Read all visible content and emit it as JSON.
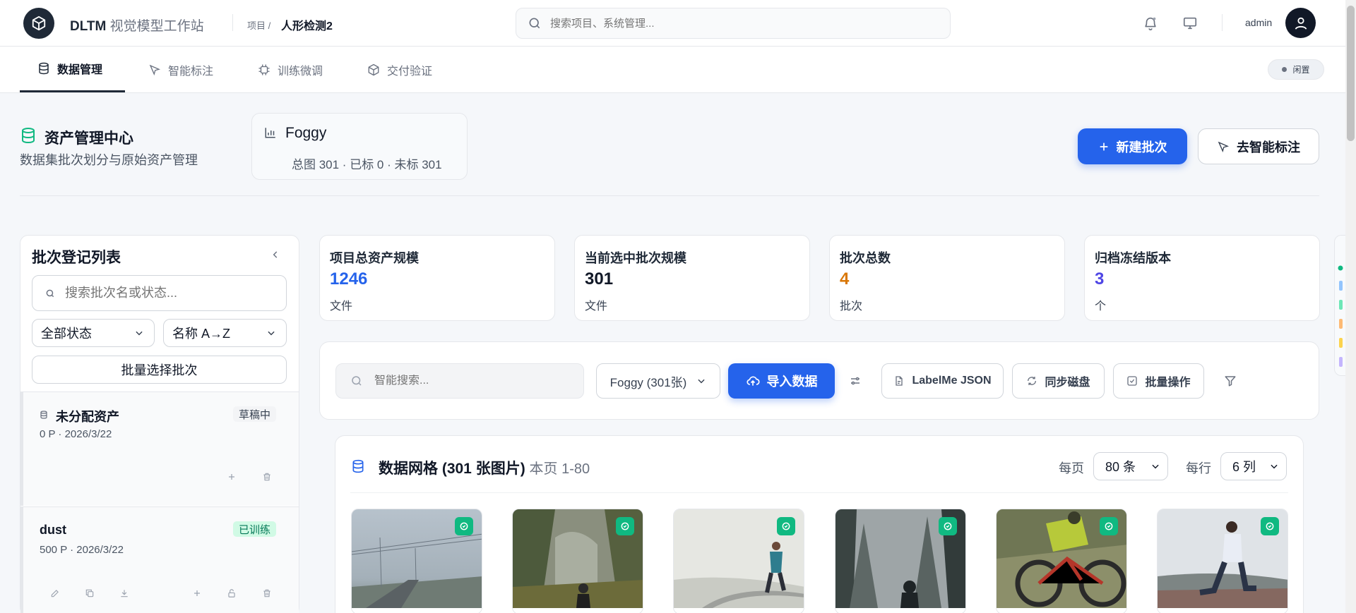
{
  "header": {
    "app_title": "DLTM",
    "app_subtitle": "视觉模型工作站",
    "breadcrumb_label": "项目 /",
    "project_name": "人形检测2",
    "search_placeholder": "搜索项目、系统管理...",
    "user": "admin"
  },
  "nav": {
    "tabs": [
      {
        "label": "数据管理",
        "icon": "database-icon",
        "active": true
      },
      {
        "label": "智能标注",
        "icon": "cursor-icon"
      },
      {
        "label": "训练微调",
        "icon": "chip-icon"
      },
      {
        "label": "交付验证",
        "icon": "box-icon"
      }
    ],
    "status": "闲置"
  },
  "page": {
    "title": "资产管理中心",
    "subtitle": "数据集批次划分与原始资产管理",
    "current_dataset": {
      "name": "Foggy",
      "stats": "总图 301 · 已标 0 · 未标 301"
    },
    "new_batch_label": "新建批次",
    "go_annotate_label": "去智能标注"
  },
  "sidebar": {
    "title": "批次登记列表",
    "search_placeholder": "搜索批次名或状态...",
    "status_filter": "全部状态",
    "sort": "名称 A→Z",
    "batch_select_label": "批量选择批次",
    "batches": [
      {
        "name": "未分配资产",
        "meta": "0 P · 2026/3/22",
        "badge": "草稿中"
      },
      {
        "name": "dust",
        "meta": "500 P · 2026/3/22",
        "badge": "已训练"
      }
    ]
  },
  "stats": [
    {
      "label": "项目总资产规模",
      "value": "1246",
      "unit": "文件",
      "color": "#2563eb"
    },
    {
      "label": "当前选中批次规模",
      "value": "301",
      "unit": "文件",
      "color": "#111827"
    },
    {
      "label": "批次总数",
      "value": "4",
      "unit": "批次",
      "color": "#d97706"
    },
    {
      "label": "归档冻结版本",
      "value": "3",
      "unit": "个",
      "color": "#4f46e5"
    }
  ],
  "toolbar": {
    "search_placeholder": "智能搜索...",
    "dataset_select": "Foggy (301张)",
    "import_label": "导入数据",
    "labelme_label": "LabelMe JSON",
    "sync_label": "同步磁盘",
    "batch_ops_label": "批量操作"
  },
  "grid": {
    "title": "数据网格 (301 张图片)",
    "range": "本页 1-80",
    "per_page_label": "每页",
    "per_page_value": "80 条",
    "per_row_label": "每行",
    "per_row_value": "6 列",
    "images": [
      {
        "scene": "foggy-road-power-lines",
        "selected": true
      },
      {
        "scene": "foggy-forest-hiker",
        "selected": true
      },
      {
        "scene": "foggy-snow-runner",
        "selected": true
      },
      {
        "scene": "foggy-pine-forest-person",
        "selected": true
      },
      {
        "scene": "mountain-biker",
        "selected": true
      },
      {
        "scene": "woman-stretching-outdoors",
        "selected": true
      }
    ]
  },
  "colors": {
    "primary": "#2563eb",
    "success": "#10b981",
    "dark": "#1f2937"
  }
}
